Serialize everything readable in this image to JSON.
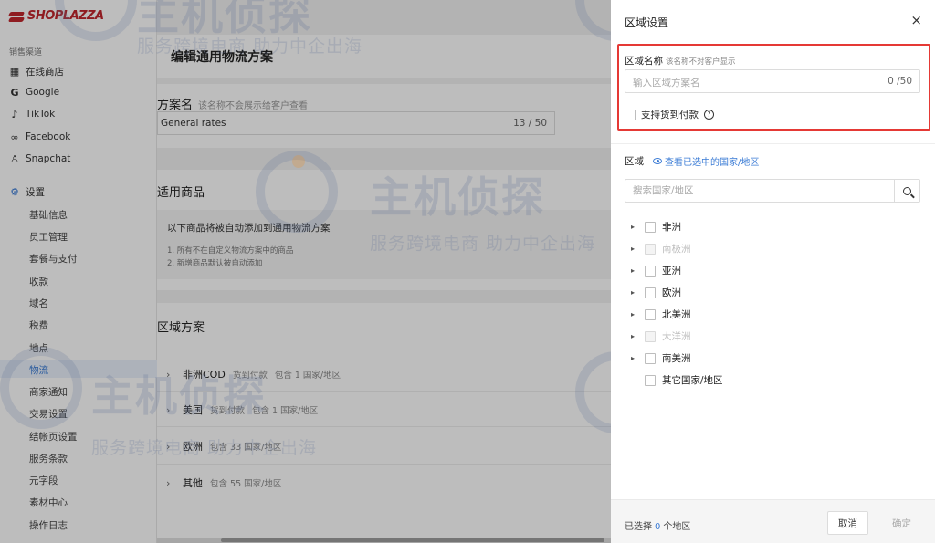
{
  "sidebar": {
    "logo": "SHOPLAZZA",
    "section_label": "销售渠道",
    "channels": [
      {
        "icon": "store-icon",
        "label": "在线商店"
      },
      {
        "icon": "google-icon",
        "label": "Google"
      },
      {
        "icon": "tiktok-icon",
        "label": "TikTok"
      },
      {
        "icon": "facebook-icon",
        "label": "Facebook"
      },
      {
        "icon": "snapchat-icon",
        "label": "Snapchat"
      }
    ],
    "settings_label": "设置",
    "settings_items": [
      "基础信息",
      "员工管理",
      "套餐与支付",
      "收款",
      "域名",
      "税费",
      "地点",
      "物流",
      "商家通知",
      "交易设置",
      "结帐页设置",
      "服务条款",
      "元字段",
      "素材中心",
      "操作日志"
    ],
    "active_item": "物流"
  },
  "main": {
    "title": "编辑通用物流方案",
    "plan_name_label": "方案名",
    "plan_name_hint": "该名称不会展示给客户查看",
    "plan_name_value": "General rates",
    "plan_name_count": "13 / 50",
    "goods_title": "适用商品",
    "goods_text": "以下商品将被自动添加到通用物流方案",
    "goods_list": [
      "1. 所有不在自定义物流方案中的商品",
      "2. 新增商品默认被自动添加"
    ],
    "zones_title": "区域方案",
    "zones": [
      {
        "name": "非洲COD",
        "tag": "货到付款",
        "meta": "包含 1 国家/地区"
      },
      {
        "name": "美国",
        "tag": "货到付款",
        "meta": "包含 1 国家/地区"
      },
      {
        "name": "欧洲",
        "tag": "",
        "meta": "包含 33 国家/地区"
      },
      {
        "name": "其他",
        "tag": "",
        "meta": "包含 55 国家/地区"
      }
    ]
  },
  "watermark": {
    "big": "主机侦探",
    "small": "服务跨境电商 助力中企出海"
  },
  "drawer": {
    "title": "区域设置",
    "close": "×",
    "name_label": "区域名称",
    "name_hint": "该名称不对客户显示",
    "name_placeholder": "输入区域方案名",
    "name_count": "0 /50",
    "cod_label": "支持货到付款",
    "area_label": "区域",
    "view_link": "查看已选中的国家/地区",
    "search_placeholder": "搜索国家/地区",
    "regions": [
      {
        "label": "非洲",
        "disabled": false,
        "expand": true
      },
      {
        "label": "南极洲",
        "disabled": true,
        "expand": true
      },
      {
        "label": "亚洲",
        "disabled": false,
        "expand": true
      },
      {
        "label": "欧洲",
        "disabled": false,
        "expand": true
      },
      {
        "label": "北美洲",
        "disabled": false,
        "expand": true
      },
      {
        "label": "大洋洲",
        "disabled": true,
        "expand": true
      },
      {
        "label": "南美洲",
        "disabled": false,
        "expand": true
      },
      {
        "label": "其它国家/地区",
        "disabled": false,
        "expand": false
      }
    ],
    "selected_prefix": "已选择",
    "selected_count": "0",
    "selected_suffix": "个地区",
    "cancel": "取消",
    "ok": "确定"
  },
  "colors": {
    "accent": "#3a7bd5",
    "highlight_border": "#e53935",
    "brand": "#c1272d"
  }
}
